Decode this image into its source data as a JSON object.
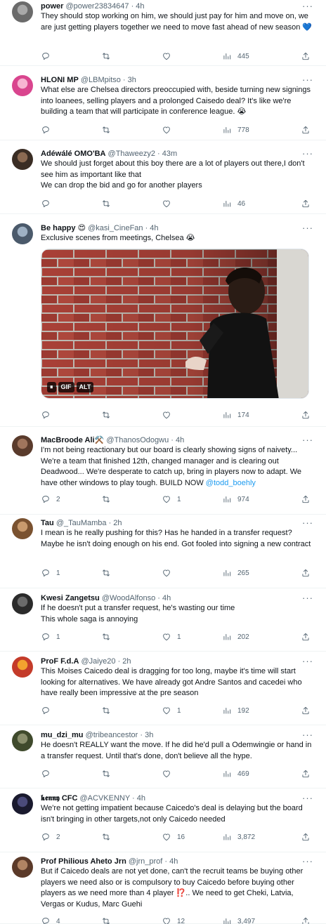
{
  "tweets": [
    {
      "name": "power",
      "handle": "@power23834647 · 4h",
      "text": "They should stop working on him, we should just pay for him and move on, we are just getting players together we need to move fast ahead of new season 💙",
      "replies": "",
      "retweets": "",
      "likes": "",
      "views": "445"
    },
    {
      "name": "HLONI MP",
      "handle": "@LBMpitso · 3h",
      "text": "What else are Chelsea directors preoccupied with, beside turning new signings into loanees, selling players and a prolonged Caisedo deal? It's like we're building a team that will participate in conference league. 😭",
      "replies": "",
      "retweets": "",
      "likes": "",
      "views": "778"
    },
    {
      "name": "Adéwálé OMO'BA",
      "handle": "@Thaweezy2 · 43m",
      "text": "We should just forget about this boy there are a lot of players out there,I don't see him as important like that\nWe can drop the bid and go for another players",
      "replies": "",
      "retweets": "",
      "likes": "",
      "views": "46"
    },
    {
      "name": "Be happy 😍",
      "handle": "@kasi_CineFan · 4h",
      "text": "Exclusive scenes from meetings, Chelsea 😭",
      "media": {
        "pause": "⏸",
        "gif": "GIF",
        "alt": "ALT"
      },
      "replies": "",
      "retweets": "",
      "likes": "",
      "views": "174"
    },
    {
      "name": "MacBroode Ali⚒️",
      "handle": "@ThanosOdogwu · 4h",
      "text": "I'm not being reactionary but our board is clearly showing signs of naivety... We're a team that finished 12th, changed manager and is clearing out Deadwood... We're desperate to catch up, bring in players now to adapt. We have other windows to play tough. BUILD NOW ",
      "mention": "@todd_boehly",
      "replies": "2",
      "retweets": "",
      "likes": "1",
      "views": "974"
    },
    {
      "name": "Tau",
      "handle": "@_TauMamba · 2h",
      "text": "I mean is he really pushing for this? Has he handed in a transfer request? Maybe he isn't doing enough on his end. Got fooled into signing a new contract",
      "replies": "1",
      "retweets": "",
      "likes": "",
      "views": "265"
    },
    {
      "name": "Kwesi Zangetsu",
      "handle": "@WoodAlfonso · 4h",
      "text": "If he doesn't put a transfer request, he's wasting our time\nThis whole saga is annoying",
      "replies": "1",
      "retweets": "",
      "likes": "1",
      "views": "202"
    },
    {
      "name": "ProF F.d.A",
      "handle": "@Jaiye20 · 2h",
      "text": "This Moises Caicedo deal is dragging for too long, maybe it's time will start looking for alternatives. We have already got Andre Santos and cacedei who have really been impressive at the pre season",
      "replies": "",
      "retweets": "",
      "likes": "1",
      "views": "192"
    },
    {
      "name": "mu_dzi_mu",
      "handle": "@tribeancestor · 3h",
      "text": "He doesn't REALLY want the move. If he did he'd pull a Odemwingie or hand in a transfer request. Until that's done, don't believe all the hype.",
      "replies": "",
      "retweets": "",
      "likes": "",
      "views": "469"
    },
    {
      "name": "𝖐𝖊𝖓𝖓𝖞 CFC",
      "handle": "@ACVKENNY · 4h",
      "text": "We're not getting impatient because Caicedo's deal is delaying but the board isn't bringing in other targets,not only Caicedo needed",
      "replies": "2",
      "retweets": "",
      "likes": "16",
      "views": "3,872"
    },
    {
      "name": "Prof Philious Aheto Jrn",
      "handle": "@jrn_prof · 4h",
      "text": "But if Caicedo deals are not yet done, can't the recruit teams be buying other players we need also or is compulsory to buy Caicedo before buying other players as we need more than 4 player ⁉️.. We need to get Cheki, Latvia, Vergas or Kudus, Marc Guehi",
      "replies": "4",
      "retweets": "",
      "likes": "12",
      "views": "3,497"
    }
  ],
  "more_label": "···",
  "icons": {
    "reply": "reply-icon",
    "retweet": "retweet-icon",
    "like": "like-icon",
    "views": "views-icon",
    "share": "share-icon"
  },
  "colors": {
    "accent": "#1d9bf0",
    "muted": "#536471",
    "text": "#0f1419",
    "divider": "#eff3f4"
  }
}
